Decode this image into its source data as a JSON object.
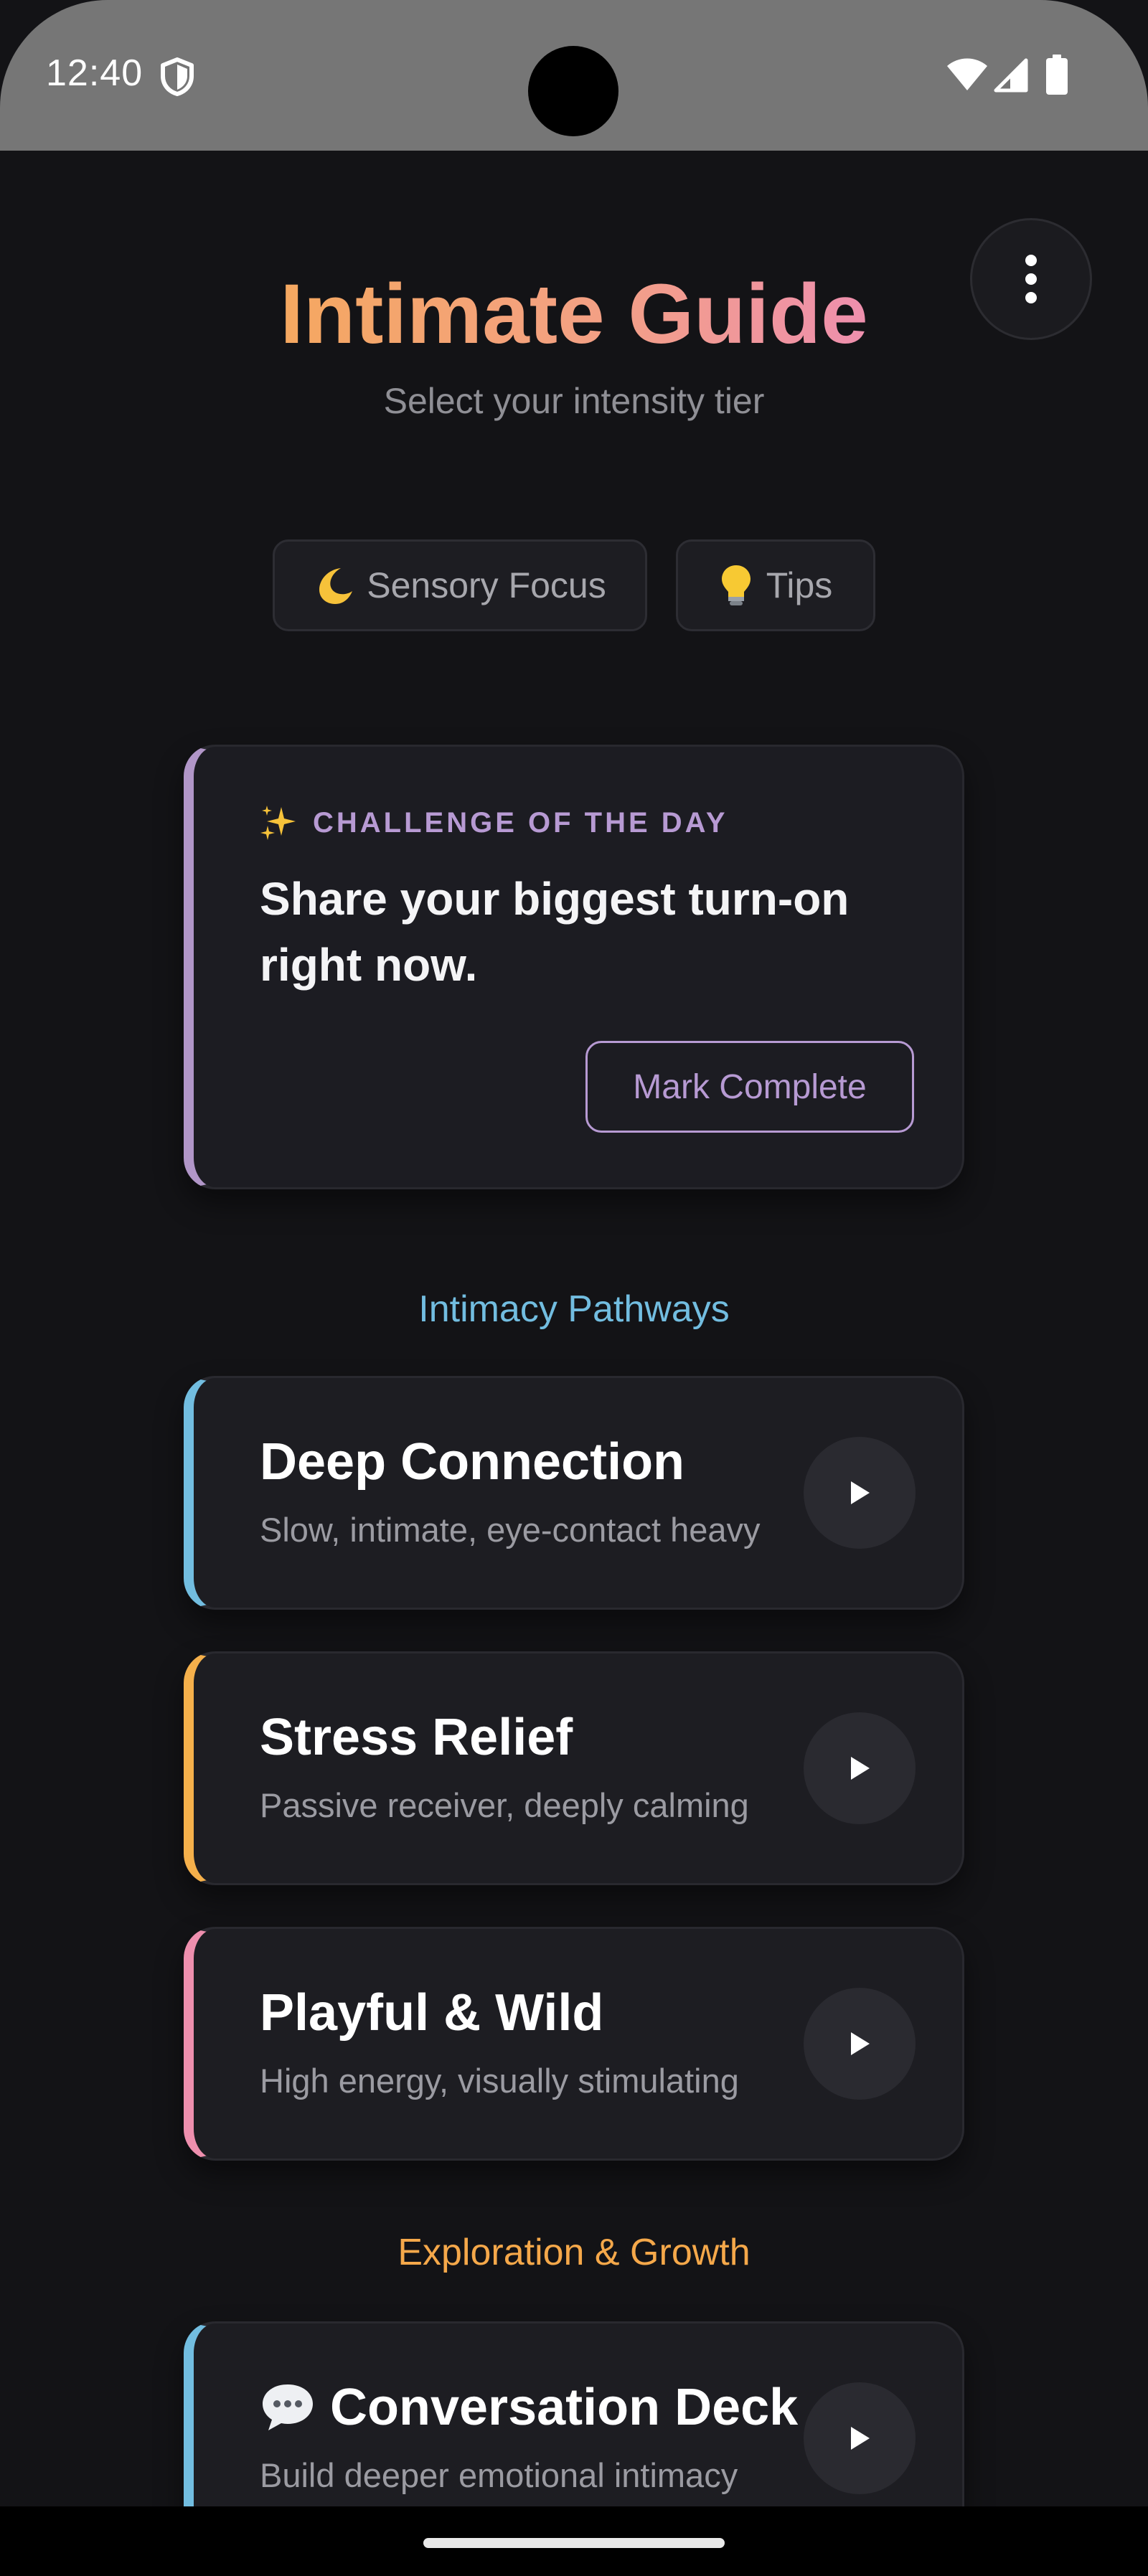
{
  "status_bar": {
    "time": "12:40",
    "icons": [
      "shield-icon",
      "wifi-icon",
      "signal-icon",
      "battery-icon"
    ]
  },
  "header": {
    "title": "Intimate Guide",
    "subtitle": "Select your intensity tier",
    "menu_icon": "more-vert-icon"
  },
  "chips": [
    {
      "icon": "crescent-moon-icon",
      "label": "Sensory Focus"
    },
    {
      "icon": "light-bulb-icon",
      "label": "Tips"
    }
  ],
  "challenge": {
    "icon": "sparkles-icon",
    "label": "CHALLENGE OF THE DAY",
    "text": "Share your biggest turn-on right now.",
    "button_label": "Mark Complete",
    "accent_color": "#b196c8"
  },
  "sections": {
    "pathways": {
      "title": "Intimacy Pathways",
      "color": "#72bde0"
    },
    "growth": {
      "title": "Exploration & Growth",
      "color": "#f5a84a"
    }
  },
  "pathways": [
    {
      "title": "Deep Connection",
      "subtitle": "Slow, intimate, eye-contact heavy",
      "accent": "#72bde0"
    },
    {
      "title": "Stress Relief",
      "subtitle": "Passive receiver, deeply calming",
      "accent": "#f5b04b"
    },
    {
      "title": "Playful & Wild",
      "subtitle": "High energy, visually stimulating",
      "accent": "#ee8fae"
    }
  ],
  "growth_items": [
    {
      "icon": "speech-bubble-icon",
      "title": "Conversation Deck",
      "subtitle": "Build deeper emotional intimacy",
      "accent": "#72bde0"
    }
  ]
}
